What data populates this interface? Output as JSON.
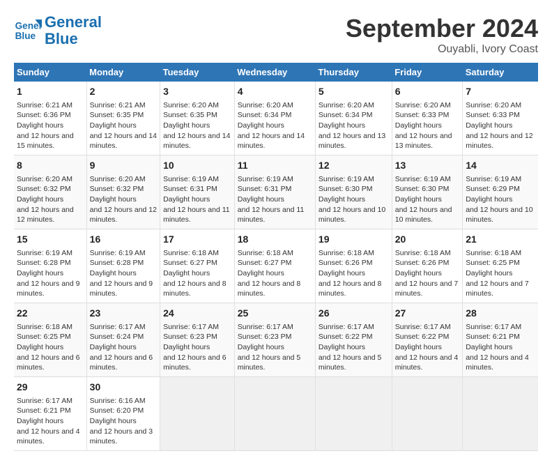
{
  "logo": {
    "line1": "General",
    "line2": "Blue"
  },
  "title": "September 2024",
  "location": "Ouyabli, Ivory Coast",
  "days_of_week": [
    "Sunday",
    "Monday",
    "Tuesday",
    "Wednesday",
    "Thursday",
    "Friday",
    "Saturday"
  ],
  "weeks": [
    [
      {
        "num": "1",
        "sunrise": "6:21 AM",
        "sunset": "6:36 PM",
        "daylight": "12 hours and 15 minutes."
      },
      {
        "num": "2",
        "sunrise": "6:21 AM",
        "sunset": "6:35 PM",
        "daylight": "12 hours and 14 minutes."
      },
      {
        "num": "3",
        "sunrise": "6:20 AM",
        "sunset": "6:35 PM",
        "daylight": "12 hours and 14 minutes."
      },
      {
        "num": "4",
        "sunrise": "6:20 AM",
        "sunset": "6:34 PM",
        "daylight": "12 hours and 14 minutes."
      },
      {
        "num": "5",
        "sunrise": "6:20 AM",
        "sunset": "6:34 PM",
        "daylight": "12 hours and 13 minutes."
      },
      {
        "num": "6",
        "sunrise": "6:20 AM",
        "sunset": "6:33 PM",
        "daylight": "12 hours and 13 minutes."
      },
      {
        "num": "7",
        "sunrise": "6:20 AM",
        "sunset": "6:33 PM",
        "daylight": "12 hours and 12 minutes."
      }
    ],
    [
      {
        "num": "8",
        "sunrise": "6:20 AM",
        "sunset": "6:32 PM",
        "daylight": "12 hours and 12 minutes."
      },
      {
        "num": "9",
        "sunrise": "6:20 AM",
        "sunset": "6:32 PM",
        "daylight": "12 hours and 12 minutes."
      },
      {
        "num": "10",
        "sunrise": "6:19 AM",
        "sunset": "6:31 PM",
        "daylight": "12 hours and 11 minutes."
      },
      {
        "num": "11",
        "sunrise": "6:19 AM",
        "sunset": "6:31 PM",
        "daylight": "12 hours and 11 minutes."
      },
      {
        "num": "12",
        "sunrise": "6:19 AM",
        "sunset": "6:30 PM",
        "daylight": "12 hours and 10 minutes."
      },
      {
        "num": "13",
        "sunrise": "6:19 AM",
        "sunset": "6:30 PM",
        "daylight": "12 hours and 10 minutes."
      },
      {
        "num": "14",
        "sunrise": "6:19 AM",
        "sunset": "6:29 PM",
        "daylight": "12 hours and 10 minutes."
      }
    ],
    [
      {
        "num": "15",
        "sunrise": "6:19 AM",
        "sunset": "6:28 PM",
        "daylight": "12 hours and 9 minutes."
      },
      {
        "num": "16",
        "sunrise": "6:19 AM",
        "sunset": "6:28 PM",
        "daylight": "12 hours and 9 minutes."
      },
      {
        "num": "17",
        "sunrise": "6:18 AM",
        "sunset": "6:27 PM",
        "daylight": "12 hours and 8 minutes."
      },
      {
        "num": "18",
        "sunrise": "6:18 AM",
        "sunset": "6:27 PM",
        "daylight": "12 hours and 8 minutes."
      },
      {
        "num": "19",
        "sunrise": "6:18 AM",
        "sunset": "6:26 PM",
        "daylight": "12 hours and 8 minutes."
      },
      {
        "num": "20",
        "sunrise": "6:18 AM",
        "sunset": "6:26 PM",
        "daylight": "12 hours and 7 minutes."
      },
      {
        "num": "21",
        "sunrise": "6:18 AM",
        "sunset": "6:25 PM",
        "daylight": "12 hours and 7 minutes."
      }
    ],
    [
      {
        "num": "22",
        "sunrise": "6:18 AM",
        "sunset": "6:25 PM",
        "daylight": "12 hours and 6 minutes."
      },
      {
        "num": "23",
        "sunrise": "6:17 AM",
        "sunset": "6:24 PM",
        "daylight": "12 hours and 6 minutes."
      },
      {
        "num": "24",
        "sunrise": "6:17 AM",
        "sunset": "6:23 PM",
        "daylight": "12 hours and 6 minutes."
      },
      {
        "num": "25",
        "sunrise": "6:17 AM",
        "sunset": "6:23 PM",
        "daylight": "12 hours and 5 minutes."
      },
      {
        "num": "26",
        "sunrise": "6:17 AM",
        "sunset": "6:22 PM",
        "daylight": "12 hours and 5 minutes."
      },
      {
        "num": "27",
        "sunrise": "6:17 AM",
        "sunset": "6:22 PM",
        "daylight": "12 hours and 4 minutes."
      },
      {
        "num": "28",
        "sunrise": "6:17 AM",
        "sunset": "6:21 PM",
        "daylight": "12 hours and 4 minutes."
      }
    ],
    [
      {
        "num": "29",
        "sunrise": "6:17 AM",
        "sunset": "6:21 PM",
        "daylight": "12 hours and 4 minutes."
      },
      {
        "num": "30",
        "sunrise": "6:16 AM",
        "sunset": "6:20 PM",
        "daylight": "12 hours and 3 minutes."
      },
      null,
      null,
      null,
      null,
      null
    ]
  ]
}
